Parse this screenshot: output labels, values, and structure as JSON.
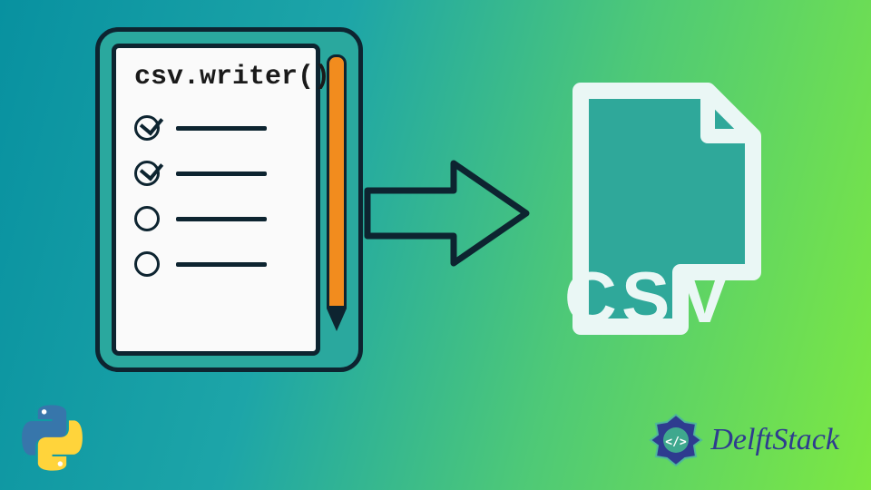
{
  "notepad": {
    "title": "csv.writer()",
    "items": [
      {
        "checked": true
      },
      {
        "checked": true
      },
      {
        "checked": false
      },
      {
        "checked": false
      }
    ]
  },
  "file": {
    "label": "CSV"
  },
  "brand": {
    "name": "DelftStack"
  },
  "colors": {
    "teal": "#2aa89e",
    "dark": "#0d2430",
    "orange": "#f28c1e",
    "fileGreen": "#2fa89a",
    "white": "#eaf7f5",
    "pythonBlue": "#3776ab",
    "pythonYellow": "#ffd43b",
    "delftBlue": "#2e3c8f"
  }
}
